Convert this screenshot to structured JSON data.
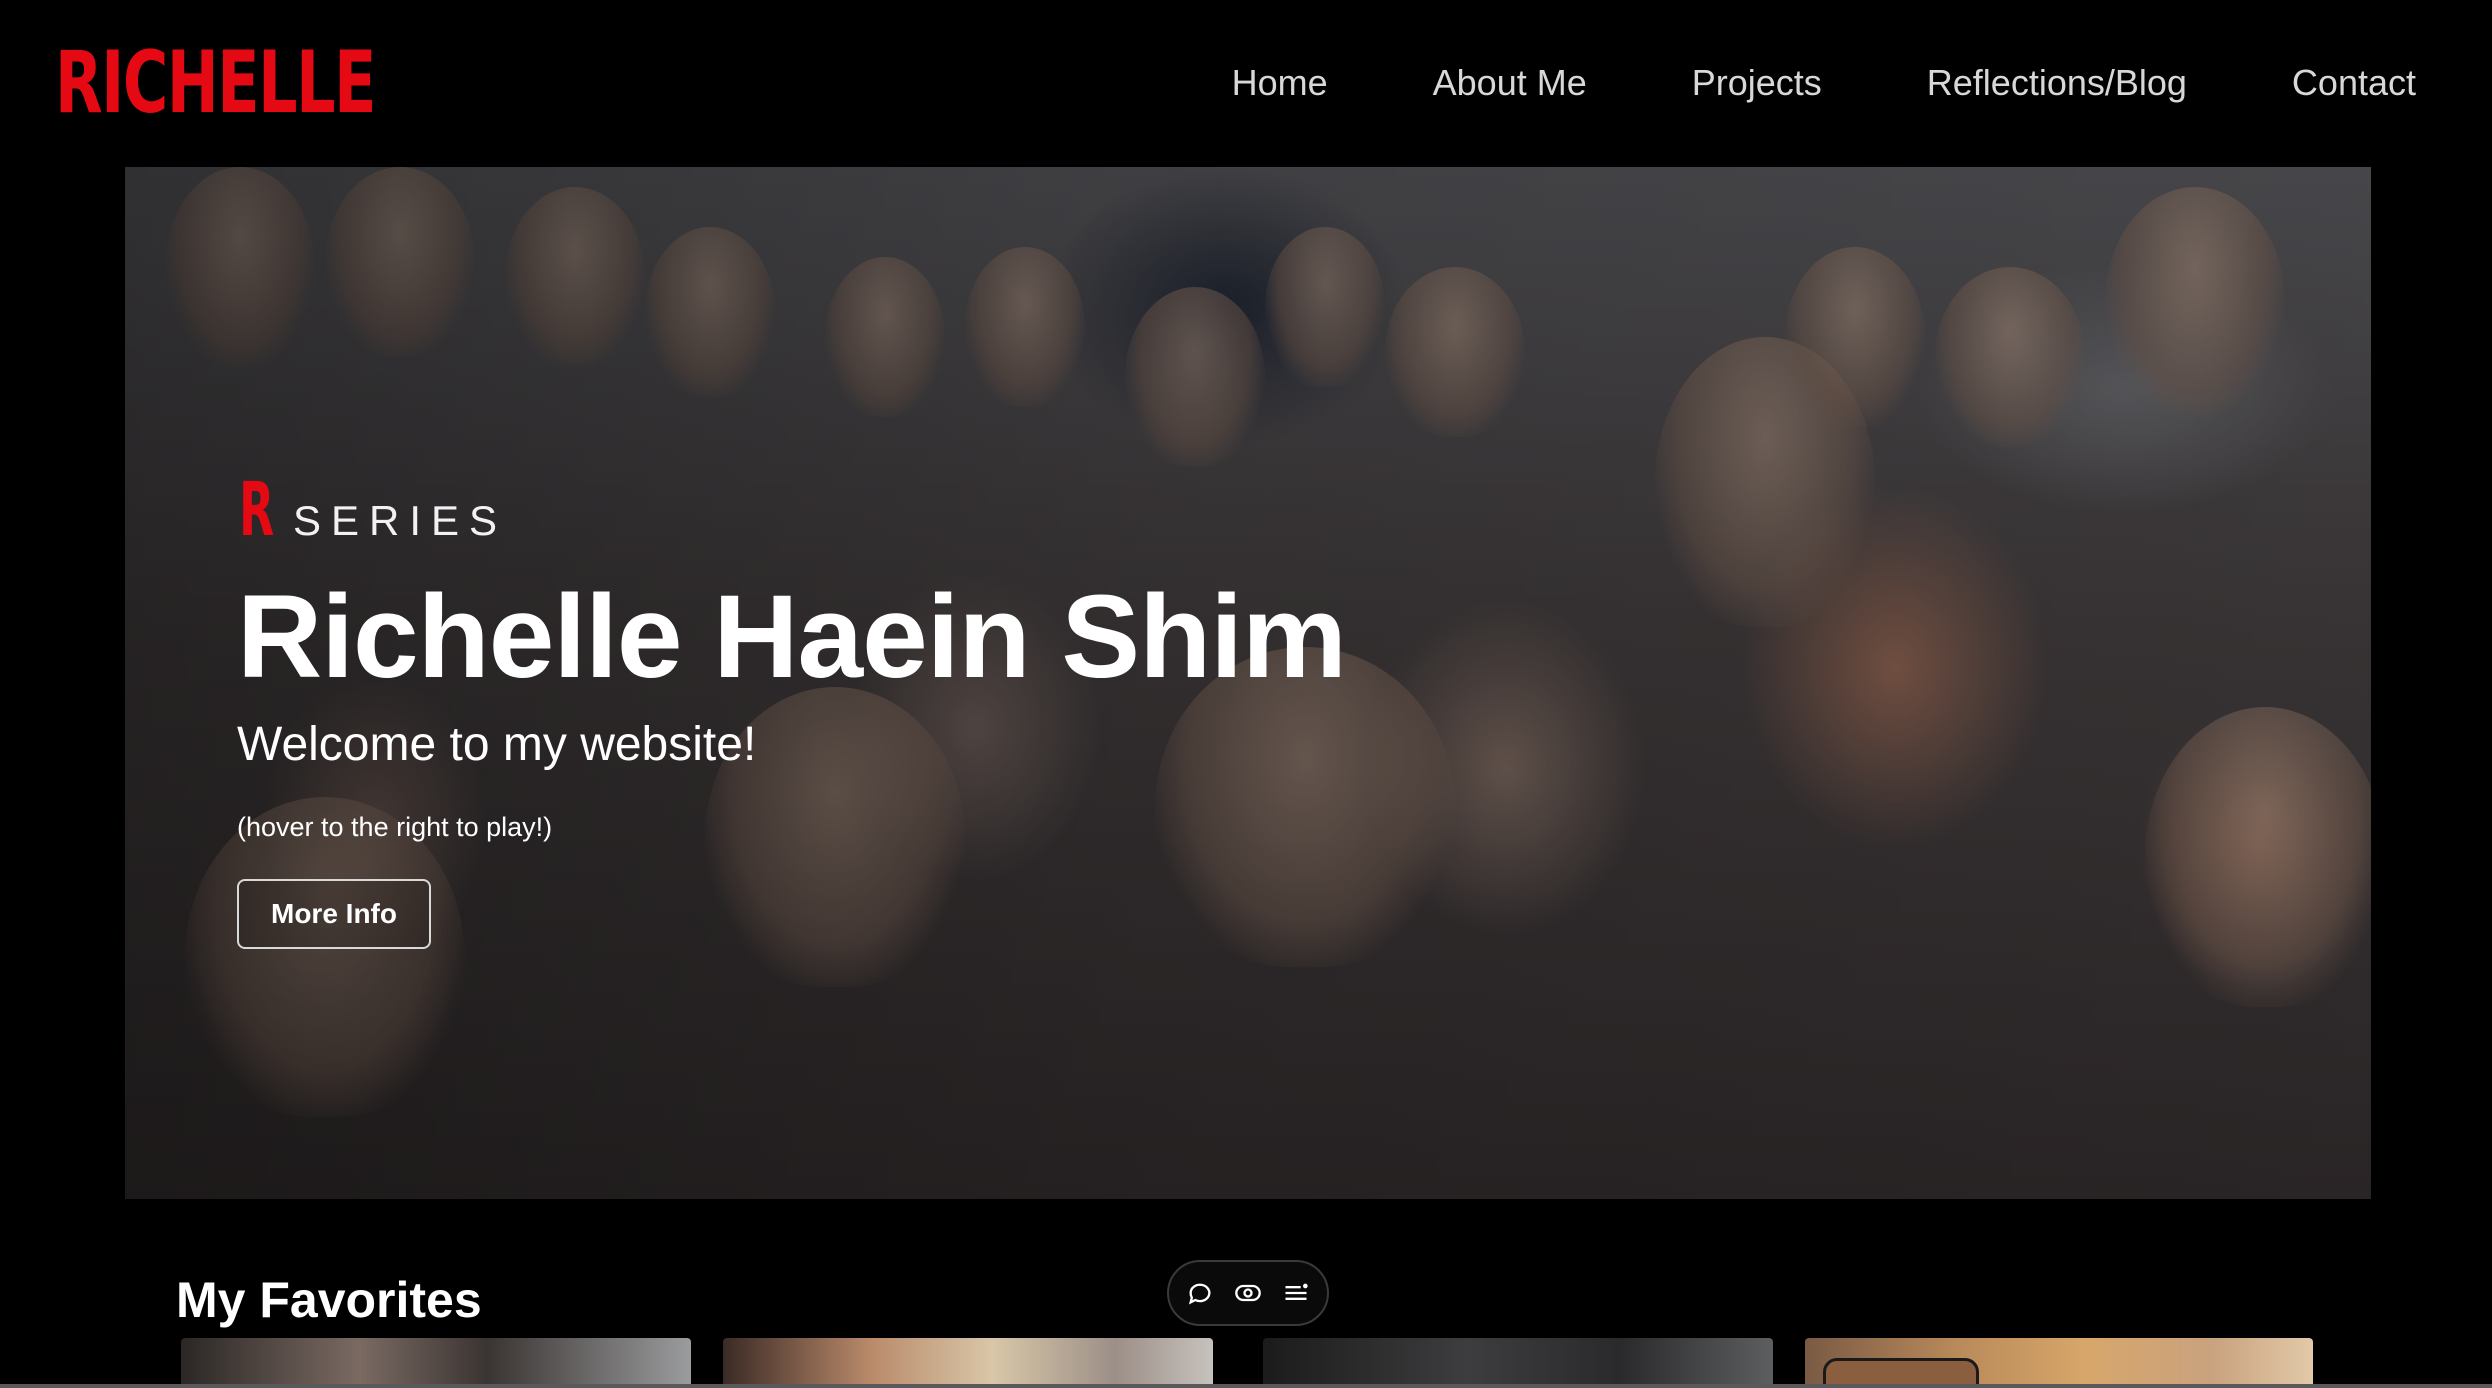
{
  "header": {
    "logo": "RICHELLE",
    "nav": [
      {
        "label": "Home"
      },
      {
        "label": "About Me"
      },
      {
        "label": "Projects"
      },
      {
        "label": "Reflections/Blog"
      },
      {
        "label": "Contact"
      }
    ]
  },
  "hero": {
    "series_letter": "R",
    "series_word": "SERIES",
    "title": "Richelle Haein Shim",
    "subtitle": "Welcome to my website!",
    "hint": "(hover to the right to play!)",
    "button_label": "More Info",
    "background": "group-photo"
  },
  "favorites": {
    "title": "My Favorites",
    "thumbnails": [
      "thumbnail-1",
      "thumbnail-2",
      "thumbnail-3",
      "thumbnail-4"
    ]
  },
  "toolbar": {
    "icons": [
      "comment-icon",
      "eye-icon",
      "menu-list-icon"
    ]
  },
  "colors": {
    "accent": "#e50914",
    "background": "#000000",
    "nav_text": "#d8d8d8"
  }
}
